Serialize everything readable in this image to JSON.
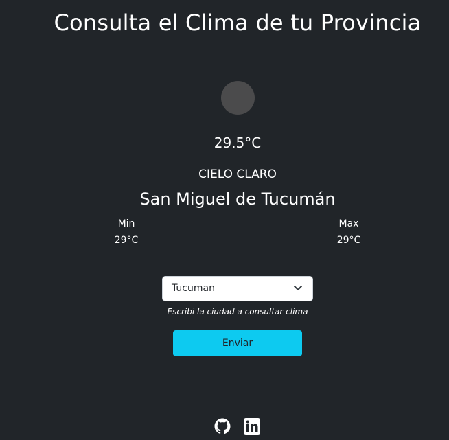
{
  "header": {
    "title": "Consulta el Clima de tu Provincia"
  },
  "weather": {
    "icon": "weather-condition-icon",
    "temperature": "29.5°C",
    "description": "CIELO CLARO",
    "city": "San Miguel de Tucumán",
    "min_label": "Min",
    "min_value": "29°C",
    "max_label": "Max",
    "max_value": "29°C"
  },
  "form": {
    "selected_city": "Tucuman",
    "hint": "Escribi la ciudad a consultar clima",
    "submit_label": "Enviar"
  },
  "footer": {
    "icons": [
      "github-icon",
      "linkedin-icon"
    ]
  },
  "colors": {
    "background": "#212529",
    "button": "#0dcaf0",
    "icon_placeholder": "#4b4b4c"
  }
}
